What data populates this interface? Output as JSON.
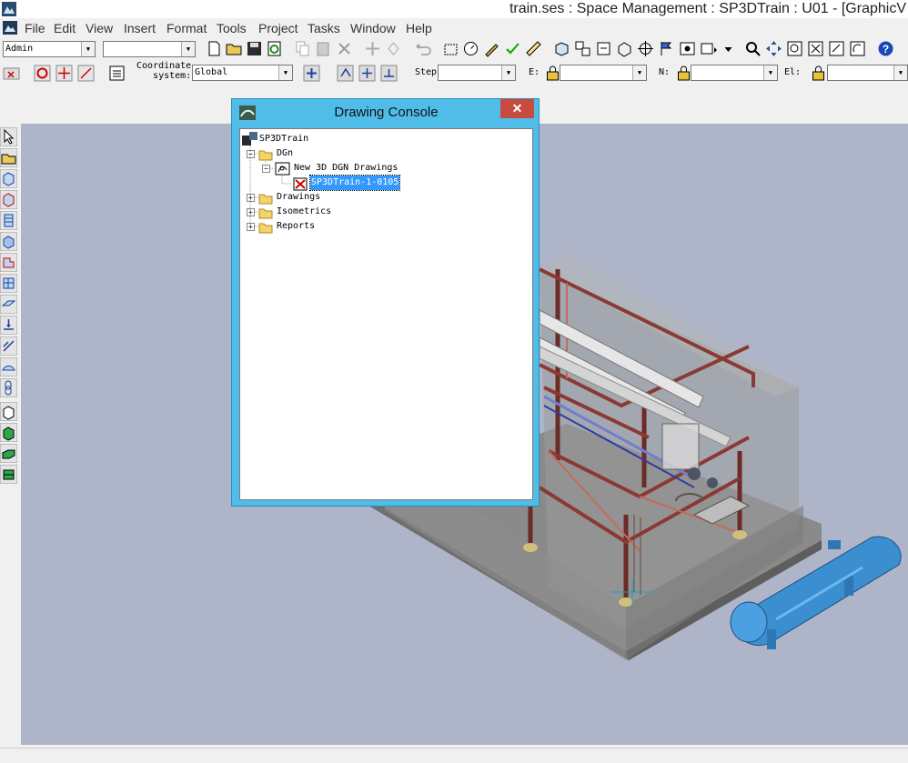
{
  "window": {
    "title": "train.ses : Space Management : SP3DTrain : U01 - [GraphicV"
  },
  "menu": [
    "File",
    "Edit",
    "View",
    "Insert",
    "Format",
    "Tools",
    "Project",
    "Tasks",
    "Window",
    "Help"
  ],
  "toolbar1": {
    "user_combo": "Admin",
    "filter_combo": ""
  },
  "toolbar2": {
    "coord_label": "Coordinate\n   system:",
    "coord_value": "Global",
    "step_label": "Step:",
    "step_value": "",
    "e_label": "E:",
    "e_value": "",
    "n_label": "N:",
    "n_value": "",
    "el_label": "El:",
    "el_value": ""
  },
  "dialog": {
    "title": "Drawing Console",
    "close_glyph": "✕",
    "tree": {
      "root": "SP3DTrain",
      "dgn": "DGn",
      "new3d": "New 3D DGN Drawings",
      "selected": "SP3DTrain-1-0105",
      "drawings": "Drawings",
      "isometrics": "Isometrics",
      "reports": "Reports"
    }
  },
  "colors": {
    "viewport_bg": "#aeb5c8",
    "dialog_frame": "#50bde8",
    "selection": "#3399ff",
    "steel": "#8a3a32",
    "vessel": "#3b8fd0",
    "close_button": "#c74b3f"
  }
}
